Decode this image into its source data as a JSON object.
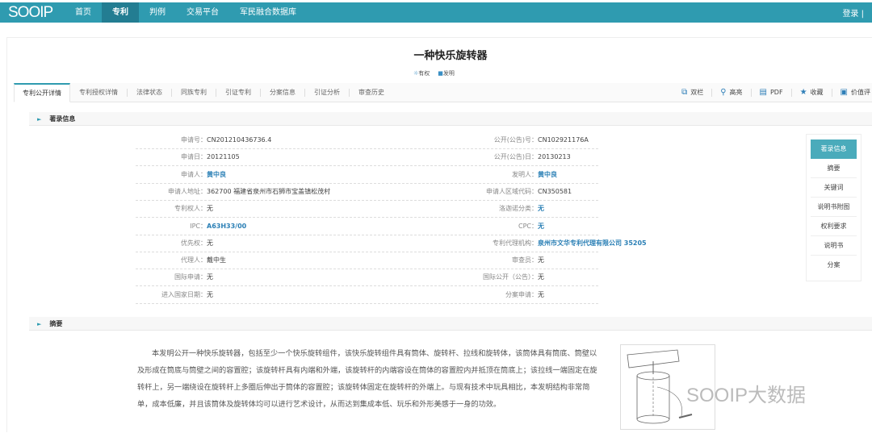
{
  "brand": {
    "logo": "SOOIP",
    "accent": "#2f9bb0"
  },
  "nav": {
    "items": [
      "首页",
      "专利",
      "判例",
      "交易平台",
      "军民融合数据库"
    ],
    "active": "专利",
    "login": "登录 |"
  },
  "patent": {
    "title": "一种快乐旋转器",
    "tags": [
      "有权",
      "发明"
    ]
  },
  "tabs": [
    "专利公开详情",
    "专利授权详情",
    "法律状态",
    "同族专利",
    "引证专利",
    "分案信息",
    "引证分析",
    "审查历史"
  ],
  "tools": [
    {
      "icon": "columns-icon",
      "label": "双栏"
    },
    {
      "icon": "pin-icon",
      "label": "高亮"
    },
    {
      "icon": "save-icon",
      "label": "PDF"
    },
    {
      "icon": "star-icon",
      "label": "收藏"
    },
    {
      "icon": "value-icon",
      "label": "价值评"
    }
  ],
  "biblio": {
    "header": "著录信息",
    "rows": [
      {
        "l": "申请号",
        "lv": "CN201210436736.4",
        "r": "公开(公告)号",
        "rv": "CN102921176A"
      },
      {
        "l": "申请日",
        "lv": "20121105",
        "r": "公开(公告)日",
        "rv": "20130213"
      },
      {
        "l": "申请人",
        "lv": "黄中良",
        "r": "发明人",
        "rv": "黄中良"
      },
      {
        "l": "申请人地址",
        "lv": "362700 福建省泉州市石狮市宝盖镇松茂村",
        "r": "申请人区域代码",
        "rv": "CN350581"
      },
      {
        "l": "专利权人",
        "lv": "无",
        "r": "洛迦诺分类",
        "rv": "无"
      },
      {
        "l": "IPC",
        "lv": "A63H33/00",
        "r": "CPC",
        "rv": "无"
      },
      {
        "l": "优先权",
        "lv": "无",
        "r": "专利代理机构",
        "rv": "泉州市文华专利代理有限公司 35205"
      },
      {
        "l": "代理人",
        "lv": "戴中生",
        "r": "审查员",
        "rv": "无"
      },
      {
        "l": "国际申请",
        "lv": "无",
        "r": "国际公开（公告）",
        "rv": "无"
      },
      {
        "l": "进入国家日期",
        "lv": "无",
        "r": "分案申请",
        "rv": "无"
      }
    ]
  },
  "side_nav": [
    "著录信息",
    "摘要",
    "关键词",
    "说明书附图",
    "权利要求",
    "说明书",
    "分案"
  ],
  "abstract": {
    "header": "摘要",
    "text": "本发明公开一种快乐旋转器，包括至少一个快乐旋转组件，该快乐旋转组件具有筒体、旋转杆、拉线和旋转体，该筒体具有筒底、筒壁以及形成在筒底与筒壁之间的容置腔；该旋转杆具有内端和外端，该旋转杆的内端容设在筒体的容置腔内并抵顶在筒底上；该拉线一端固定在旋转杆上，另一端绕设在旋转杆上多圈后伸出于筒体的容置腔；该旋转体固定在旋转杆的外端上。与现有技术中玩具相比，本发明结构非常简单，成本低廉，并且该筒体及旋转体均可以进行艺术设计，从而达到集成本低、玩乐和外形美感于一身的功效。"
  },
  "watermark": "SOOIP大数据"
}
